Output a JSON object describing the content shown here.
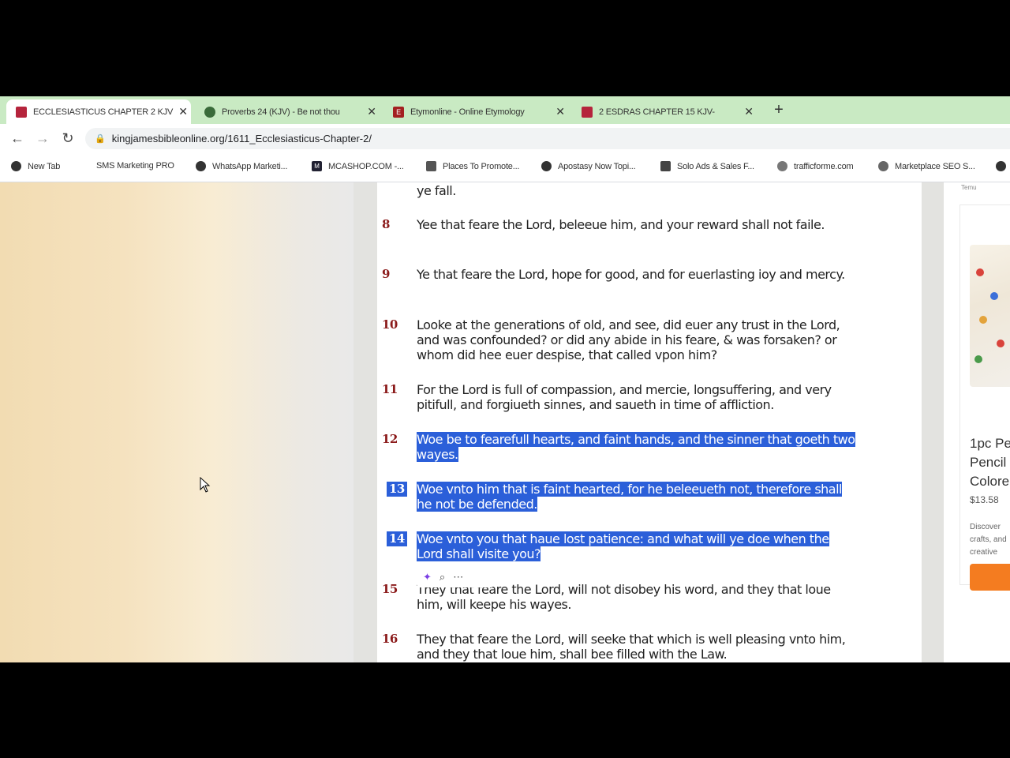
{
  "tabs": [
    {
      "title": "ECCLESIASTICUS CHAPTER 2 KJV",
      "favicon": "bible-icon",
      "color": "#b5243c",
      "active": true
    },
    {
      "title": "Proverbs 24 (KJV) - Be not thou",
      "favicon": "link-icon",
      "color": "#3a6b3a",
      "active": false
    },
    {
      "title": "Etymonline - Online Etymology",
      "favicon": "etymonline-icon",
      "color": "#a32020",
      "active": false
    },
    {
      "title": "2 ESDRAS CHAPTER 15 KJV-",
      "favicon": "bible-icon",
      "color": "#b5243c",
      "active": false
    }
  ],
  "address": {
    "url": "kingjamesbibleonline.org/1611_Ecclesiasticus-Chapter-2/"
  },
  "bookmarks": [
    "New Tab",
    "SMS Marketing PRO",
    "WhatsApp Marketi...",
    "MCASHOP.COM -...",
    "Places To Promote...",
    "Apostasy Now Topi...",
    "Solo Ads & Sales F...",
    "trafficforme.com",
    "Marketplace SEO S..."
  ],
  "article": {
    "partial_verse": "ye fall.",
    "verses": [
      {
        "num": "8",
        "text": "Yee that feare the Lord, beleeue him, and your reward shall not faile.",
        "selected": false
      },
      {
        "num": "9",
        "text": "Ye that feare the Lord, hope for good, and for euerlasting ioy and mercy.",
        "selected": false
      },
      {
        "num": "10",
        "text": "Looke at the generations of old, and see, did euer any trust in the Lord, and was confounded? or did any abide in his feare, & was forsaken? or whom did hee euer despise, that called vpon him?",
        "selected": false
      },
      {
        "num": "11",
        "text": "For the Lord is full of compassion, and mercie, longsuffering, and very pitifull, and forgiueth sinnes, and saueth in time of affliction.",
        "selected": false
      },
      {
        "num": "12",
        "text": "Woe be to fearefull hearts, and faint hands, and the sinner that goeth two wayes.",
        "selected": true
      },
      {
        "num": "13",
        "text": "Woe vnto him that is faint hearted, for he beleeueth not, therefore shall he not be defended.",
        "selected": true
      },
      {
        "num": "14",
        "text": "Woe vnto you that haue lost patience: and what will ye doe when the Lord shall visite you?",
        "selected": true
      },
      {
        "num": "15",
        "text": "They that feare the Lord, will not disobey his word, and they that loue him, will keepe his wayes.",
        "selected": false
      },
      {
        "num": "16",
        "text": "They that feare the Lord, will seeke that which is well pleasing vnto him, and they that loue him, shall bee filled with the Law.",
        "selected": false
      }
    ]
  },
  "ad": {
    "tag": "Temu",
    "title_lines": [
      "1pc Pe",
      "Pencil",
      "Colore"
    ],
    "price": "$13.58",
    "desc_lines": [
      "Discover",
      "crafts, and",
      "creative"
    ],
    "button_color": "#f47c20"
  },
  "selection_toolbar": {
    "icons": [
      "sparkle-icon",
      "search-icon",
      "more-icon"
    ]
  },
  "colors": {
    "tab_strip": "#c9eac3",
    "selection": "#2b5fd9",
    "verse_number": "#8b1a1a"
  }
}
